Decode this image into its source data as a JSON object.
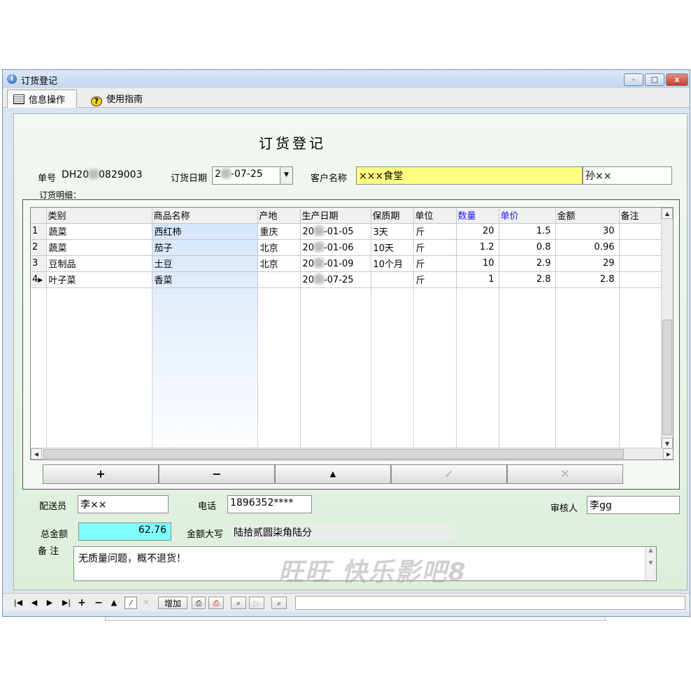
{
  "window": {
    "title": "订货登记",
    "controls": [
      "-",
      "□",
      "x"
    ]
  },
  "tabs": [
    {
      "label": "信息操作",
      "icon": "book-icon",
      "active": true
    },
    {
      "label": "使用指南",
      "icon": "help-icon",
      "active": false
    }
  ],
  "form": {
    "title": "订货登记",
    "order_no_label": "单号",
    "order_no_prefix": "DH20",
    "order_no_suffix": "0829003",
    "order_date_label": "订货日期",
    "order_date_prefix": "2",
    "order_date_suffix": "-07-25",
    "customer_label": "客户名称",
    "customer_name": "×××食堂",
    "contact": "孙××",
    "details_label": "订货明细："
  },
  "grid": {
    "columns": [
      "类别",
      "商品名称",
      "产地",
      "生产日期",
      "保质期",
      "单位",
      "数量",
      "单价",
      "金额",
      "备注"
    ],
    "highlight_columns": [
      "数量",
      "单价"
    ],
    "rows": [
      {
        "rownum": "1",
        "category": "蔬菜",
        "product": "西红柿",
        "origin": "重庆",
        "date_prefix": "20",
        "date_suffix": "-01-05",
        "shelf_life": "3天",
        "unit": "斤",
        "qty": "20",
        "price": "1.5",
        "amount": "30",
        "note": ""
      },
      {
        "rownum": "2",
        "category": "蔬菜",
        "product": "茄子",
        "origin": "北京",
        "date_prefix": "20",
        "date_suffix": "-01-06",
        "shelf_life": "10天",
        "unit": "斤",
        "qty": "1.2",
        "price": "0.8",
        "amount": "0.96",
        "note": ""
      },
      {
        "rownum": "3",
        "category": "豆制品",
        "product": "土豆",
        "origin": "北京",
        "date_prefix": "20",
        "date_suffix": "-01-09",
        "shelf_life": "10个月",
        "unit": "斤",
        "qty": "10",
        "price": "2.9",
        "amount": "29",
        "note": ""
      },
      {
        "rownum": "4",
        "category": "叶子菜",
        "product": "香菜",
        "origin": "",
        "date_prefix": "20",
        "date_suffix": "-07-25",
        "shelf_life": "",
        "unit": "斤",
        "qty": "1",
        "price": "2.8",
        "amount": "2.8",
        "note": ""
      }
    ],
    "buttons": [
      "+",
      "−",
      "▲",
      "✓",
      "✕"
    ]
  },
  "footer": {
    "delivery_label": "配送员",
    "delivery_value": "李××",
    "phone_label": "电话",
    "phone_value": "1896352****",
    "auditor_label": "审核人",
    "auditor_value": "李gg",
    "total_label": "总金额",
    "total_value": "62.76",
    "uppercase_label": "金额大写",
    "uppercase_value": "陆拾贰圆柒角陆分",
    "memo_label": "备 注",
    "memo_value": "无质量问题，概不退货！"
  },
  "watermark": "旺旺  快乐影吧8",
  "navbar": {
    "add_label": "增加"
  }
}
